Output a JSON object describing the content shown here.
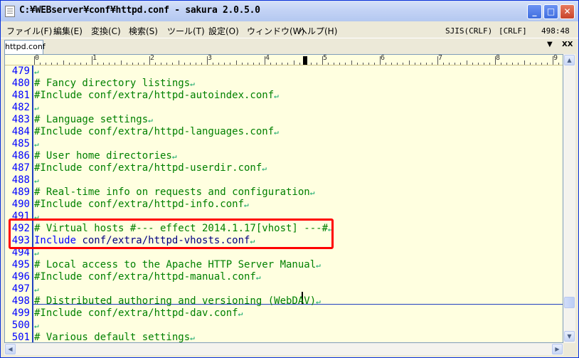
{
  "window": {
    "title": "C:¥WEBserver¥conf¥httpd.conf - sakura 2.0.5.0",
    "min_glyph": "_",
    "max_glyph": "□",
    "close_glyph": "✕"
  },
  "menu": {
    "items": [
      "ファイル(F)",
      "編集(E)",
      "変換(C)",
      "検索(S)",
      "ツール(T)",
      "設定(O)",
      "ウィンドウ(W)",
      "ヘルプ(H)"
    ],
    "encoding": "SJIS(CRLF)",
    "linebreak": "[CRLF]",
    "position": "498:48"
  },
  "tabs": {
    "items": [
      "httpd.conf"
    ],
    "dropdown_glyph": "▼",
    "close_label": "XX"
  },
  "ruler": {
    "labels": [
      "0",
      "1",
      "2",
      "3",
      "4",
      "5",
      "6",
      "7",
      "8",
      "9"
    ]
  },
  "editor": {
    "eol_glyph": "↵",
    "lines": [
      {
        "num": "479",
        "text": ""
      },
      {
        "num": "480",
        "text": "# Fancy directory listings"
      },
      {
        "num": "481",
        "text": "#Include conf/extra/httpd-autoindex.conf"
      },
      {
        "num": "482",
        "text": ""
      },
      {
        "num": "483",
        "text": "# Language settings"
      },
      {
        "num": "484",
        "text": "#Include conf/extra/httpd-languages.conf"
      },
      {
        "num": "485",
        "text": ""
      },
      {
        "num": "486",
        "text": "# User home directories"
      },
      {
        "num": "487",
        "text": "#Include conf/extra/httpd-userdir.conf"
      },
      {
        "num": "488",
        "text": ""
      },
      {
        "num": "489",
        "text": "# Real-time info on requests and configuration"
      },
      {
        "num": "490",
        "text": "#Include conf/extra/httpd-info.conf"
      },
      {
        "num": "491",
        "text": ""
      },
      {
        "num": "492",
        "text": "# Virtual hosts #--- effect 2014.1.17[vhost] ---#"
      },
      {
        "num": "493",
        "text": "conf/extra/httpd-vhosts.conf",
        "keyword": "Include"
      },
      {
        "num": "494",
        "text": ""
      },
      {
        "num": "495",
        "text": "# Local access to the Apache HTTP Server Manual"
      },
      {
        "num": "496",
        "text": "#Include conf/extra/httpd-manual.conf"
      },
      {
        "num": "497",
        "text": ""
      },
      {
        "num": "498",
        "text": "# Distributed authoring and versioning (WebDAV)"
      },
      {
        "num": "499",
        "text": "#Include conf/extra/httpd-dav.conf"
      },
      {
        "num": "500",
        "text": ""
      },
      {
        "num": "501",
        "text": "# Various default settings"
      }
    ]
  },
  "scrollbars": {
    "up_glyph": "▲",
    "down_glyph": "▼",
    "left_glyph": "◀",
    "right_glyph": "▶"
  }
}
